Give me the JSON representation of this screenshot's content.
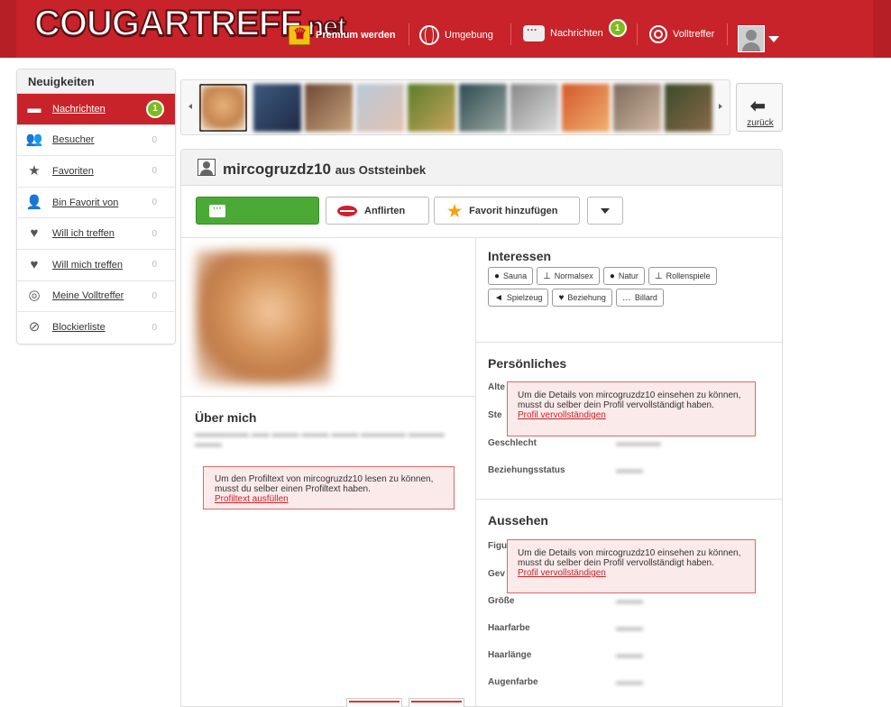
{
  "header": {
    "logo": "COUGARTREFF",
    "logo_tld": ".net",
    "nav": {
      "premium": "Premium werden",
      "umgebung": "Umgebung",
      "nachrichten": "Nachrichten",
      "nachrichten_badge": "1",
      "volltreffer": "Volltreffer"
    }
  },
  "sidebar": {
    "title": "Neuigkeiten",
    "items": [
      {
        "label": "Nachrichten",
        "count": "1",
        "icon": "chat-icon"
      },
      {
        "label": "Besucher",
        "count": "0",
        "icon": "users-icon"
      },
      {
        "label": "Favoriten",
        "count": "0",
        "icon": "star-icon"
      },
      {
        "label": "Bin Favorit von",
        "count": "0",
        "icon": "user-star-icon"
      },
      {
        "label": "Will ich treffen",
        "count": "0",
        "icon": "hearts-icon"
      },
      {
        "label": "Will mich treffen",
        "count": "0",
        "icon": "hearts-icon"
      },
      {
        "label": "Meine Volltreffer",
        "count": "0",
        "icon": "target-icon"
      },
      {
        "label": "Blockierliste",
        "count": "0",
        "icon": "block-user-icon"
      }
    ]
  },
  "strip": {
    "back_label": "zurück"
  },
  "profile": {
    "username": "mircogruzdz10",
    "location": "aus Oststeinbek",
    "actions": {
      "flirt": "Anflirten",
      "favorite": "Favorit hinzufügen"
    },
    "about": {
      "title": "Über mich",
      "notice_text": "Um den Profiltext von mircogruzdz10 lesen zu können, musst du selber einen Profiltext haben.",
      "notice_link": "Profiltext ausfüllen"
    },
    "interests": {
      "title": "Interessen",
      "tags": [
        {
          "label": "Sauna",
          "icon": "pin-icon"
        },
        {
          "label": "Normalsex",
          "icon": "bed-icon"
        },
        {
          "label": "Natur",
          "icon": "pin-icon"
        },
        {
          "label": "Rollenspiele",
          "icon": "bed-icon"
        },
        {
          "label": "Spielzeug",
          "icon": "toy-icon"
        },
        {
          "label": "Beziehung",
          "icon": "hearts-icon"
        },
        {
          "label": "Billard",
          "icon": "dots-icon"
        }
      ]
    },
    "personal": {
      "title": "Persönliches",
      "labels": [
        "Alter",
        "Sternzeichen",
        "Geschlecht",
        "Beziehungsstatus"
      ],
      "visible_labels": [
        "Alte",
        "Ste",
        "Geschlecht",
        "Beziehungsstatus"
      ],
      "notice_text": "Um die Details von mircogruzdz10 einsehen zu können, musst du selber dein Profil vervollständigt haben.",
      "notice_link": "Profil vervollständigen"
    },
    "looks": {
      "title": "Aussehen",
      "visible_labels": [
        "Figu",
        "Gev",
        "Größe",
        "Haarfarbe",
        "Haarlänge",
        "Augenfarbe"
      ],
      "notice_text": "Um die Details von mircogruzdz10 einsehen zu können, musst du selber dein Profil vervollständigt haben.",
      "notice_link": "Profil vervollständigen"
    }
  },
  "colors": {
    "brand_red": "#c8232a",
    "green": "#4aaa35",
    "badge_green": "#7dbb1f"
  }
}
